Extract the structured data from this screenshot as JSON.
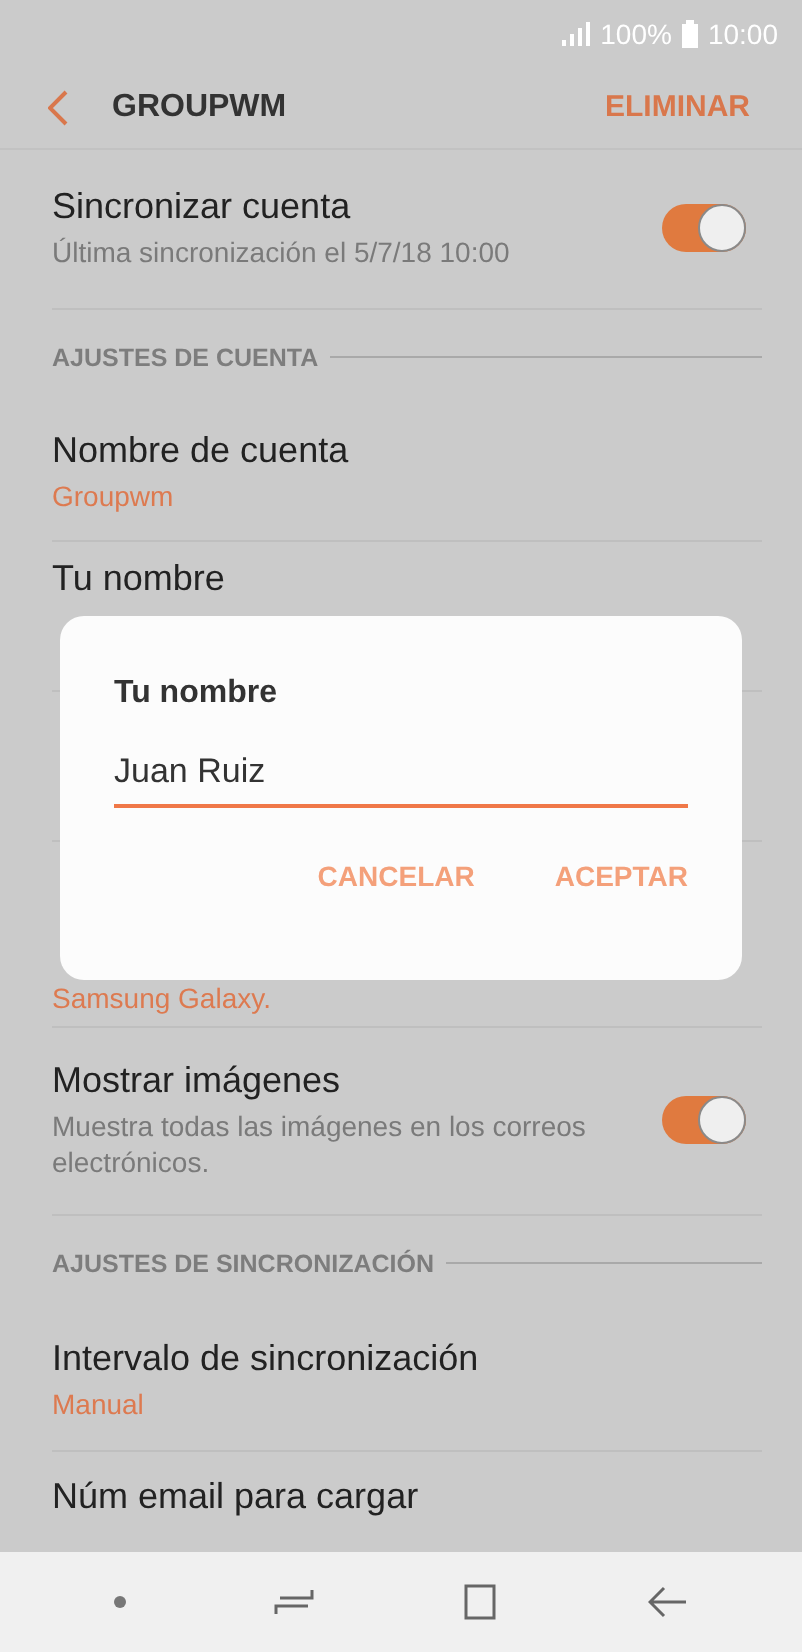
{
  "status_bar": {
    "battery": "100%",
    "time": "10:00"
  },
  "header": {
    "title": "GROUPWM",
    "action": "ELIMINAR"
  },
  "items": [
    {
      "kind": "toggle",
      "title": "Sincronizar cuenta",
      "summary": "Última sincronización el 5/7/18  10:00",
      "on": true
    },
    {
      "kind": "section",
      "title": "AJUSTES DE CUENTA"
    },
    {
      "kind": "text",
      "title": "Nombre de cuenta",
      "summary": "Groupwm"
    },
    {
      "kind": "text",
      "title": "Tu nombre"
    },
    {
      "kind": "hidden"
    },
    {
      "kind": "tail",
      "summary": "Samsung Galaxy."
    },
    {
      "kind": "toggle",
      "title": "Mostrar imágenes",
      "summary": "Muestra todas las imágenes en los correos electrónicos.",
      "on": true
    },
    {
      "kind": "section",
      "title": "AJUSTES DE SINCRONIZACIÓN"
    },
    {
      "kind": "text",
      "title": "Intervalo de sincronización",
      "summary": "Manual"
    },
    {
      "kind": "text",
      "title": "Núm email para cargar"
    }
  ],
  "dialog": {
    "title": "Tu nombre",
    "value": "Juan Ruiz",
    "buttons": [
      "CANCELAR",
      "ACEPTAR"
    ]
  }
}
